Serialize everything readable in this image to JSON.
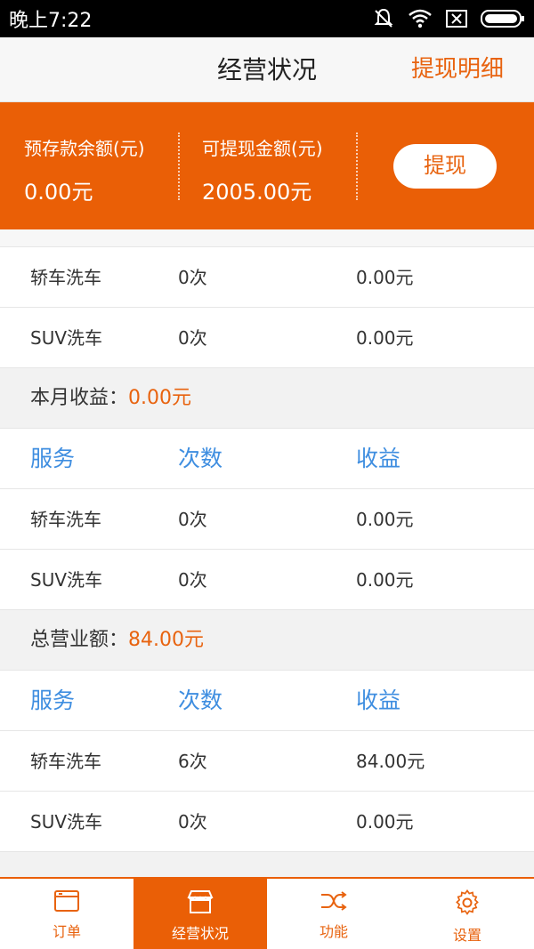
{
  "status_bar": {
    "time": "晚上7:22"
  },
  "app_bar": {
    "title": "经营状况",
    "action": "提现明细"
  },
  "banner": {
    "deposit_label": "预存款余额(元)",
    "deposit_value": "0.00元",
    "withdrawable_label": "可提现金额(元)",
    "withdrawable_value": "2005.00元",
    "withdraw_button": "提现"
  },
  "today": {
    "rows": [
      {
        "service": "轿车洗车",
        "count": "0次",
        "income": "0.00元"
      },
      {
        "service": "SUV洗车",
        "count": "0次",
        "income": "0.00元"
      }
    ]
  },
  "month": {
    "label": "本月收益：",
    "amount": "0.00元",
    "headers": {
      "service": "服务",
      "count": "次数",
      "income": "收益"
    },
    "rows": [
      {
        "service": "轿车洗车",
        "count": "0次",
        "income": "0.00元"
      },
      {
        "service": "SUV洗车",
        "count": "0次",
        "income": "0.00元"
      }
    ]
  },
  "total": {
    "label": "总营业额：",
    "amount": "84.00元",
    "headers": {
      "service": "服务",
      "count": "次数",
      "income": "收益"
    },
    "rows": [
      {
        "service": "轿车洗车",
        "count": "6次",
        "income": "84.00元"
      },
      {
        "service": "SUV洗车",
        "count": "0次",
        "income": "0.00元"
      }
    ]
  },
  "tabs": [
    {
      "label": "订单",
      "icon": "window-icon"
    },
    {
      "label": "经营状况",
      "icon": "store-icon"
    },
    {
      "label": "功能",
      "icon": "shuffle-icon"
    },
    {
      "label": "设置",
      "icon": "gear-icon"
    }
  ],
  "colors": {
    "accent": "#ea5f06",
    "header_blue": "#3f8ee0"
  }
}
